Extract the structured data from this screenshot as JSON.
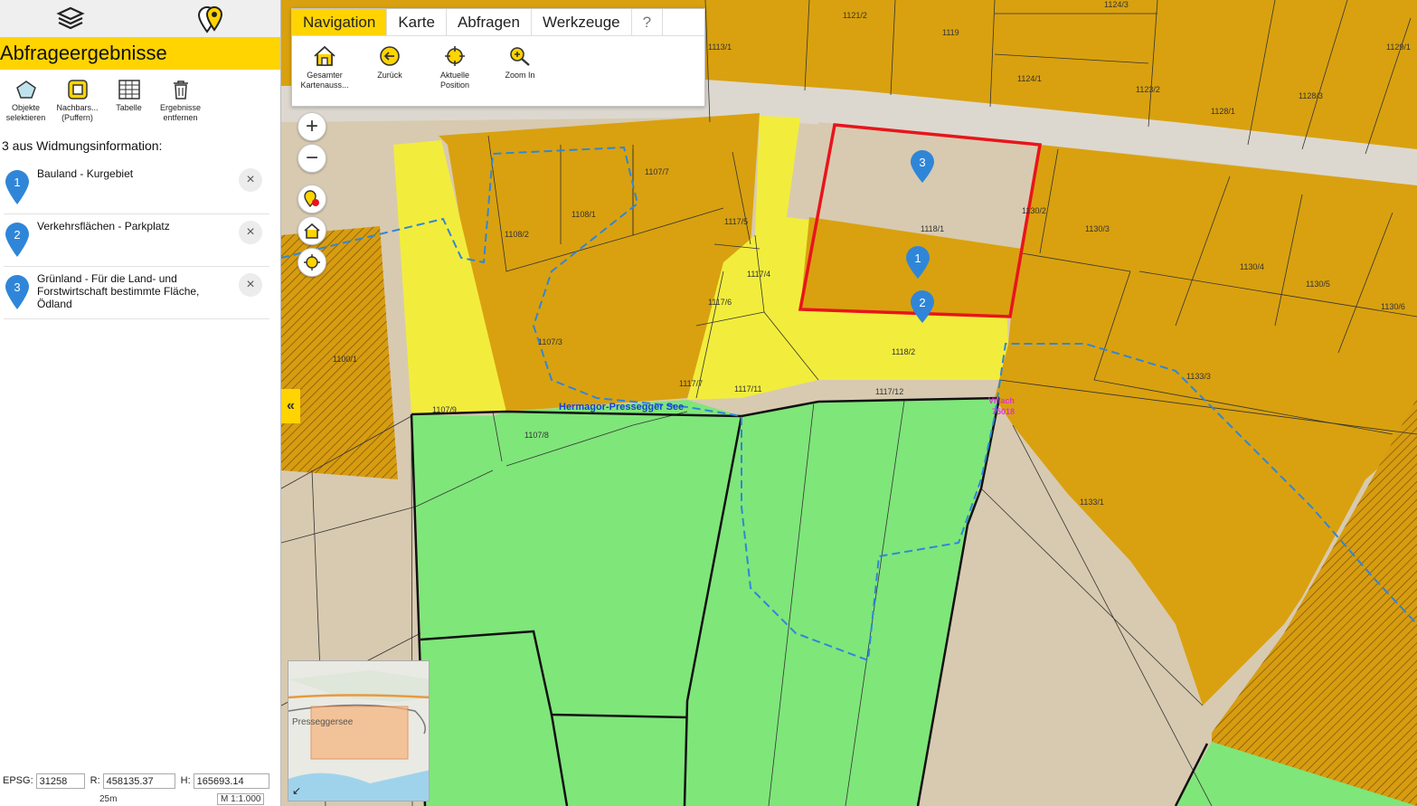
{
  "panel": {
    "title": "Abfrageergebnisse",
    "tabs": [
      "layers-icon",
      "query-pins-icon"
    ],
    "tools": [
      {
        "label_1": "Objekte",
        "label_2": "selektieren",
        "icon": "pentagon-select-icon"
      },
      {
        "label_1": "Nachbars...",
        "label_2": "(Puffern)",
        "icon": "buffer-icon"
      },
      {
        "label_1": "Tabelle",
        "label_2": "",
        "icon": "table-icon"
      },
      {
        "label_1": "Ergebnisse",
        "label_2": "entfernen",
        "icon": "trash-icon"
      }
    ],
    "result_heading": "3 aus Widmungsinformation:",
    "results": [
      {
        "num": "1",
        "text": "Bauland - Kurgebiet"
      },
      {
        "num": "2",
        "text": "Verkehrsflächen - Parkplatz"
      },
      {
        "num": "3",
        "text": "Grünland - Für die Land- und Forstwirtschaft bestimmte Fläche, Ödland"
      }
    ],
    "close_glyph": "×",
    "collapse_glyph": "«"
  },
  "status": {
    "epsg_label": "EPSG:",
    "epsg_value": "31258",
    "r_label": "R:",
    "r_value": "458135.37",
    "h_label": "H:",
    "h_value": "165693.14",
    "scale_bar": "25m",
    "scale_value": "M 1:1.000"
  },
  "menu": {
    "tabs": [
      "Navigation",
      "Karte",
      "Abfragen",
      "Werkzeuge",
      "?"
    ],
    "active_tab": "Navigation",
    "items": [
      {
        "label_1": "Gesamter",
        "label_2": "Kartenauss...",
        "icon": "home-icon"
      },
      {
        "label_1": "Zurück",
        "label_2": "",
        "icon": "back-arrow-icon"
      },
      {
        "label_1": "Aktuelle",
        "label_2": "Position",
        "icon": "crosshair-icon"
      },
      {
        "label_1": "Zoom In",
        "label_2": "",
        "icon": "zoom-in-icon"
      }
    ]
  },
  "map_controls": {
    "zoom_in": "+",
    "zoom_out": "−"
  },
  "map": {
    "parcels": [
      "1113/1",
      "1121/2",
      "1119",
      "1124/3",
      "1129/1",
      "1124/1",
      "1123/2",
      "1128/3",
      "1128/1",
      "1107/7",
      "1108/1",
      "1108/2",
      "1117/5",
      "1117/4",
      "1117/6",
      "1118/1",
      "1130/2",
      "1130/3",
      "1130/4",
      "1130/5",
      "1130/6",
      "1133/3",
      "1100/1",
      "1107/3",
      "1118/2",
      "1117/7",
      "1117/11",
      "1117/12",
      "1107/9",
      "1107/8",
      "1133/1"
    ],
    "place_label": "Hermagor-Pressegger See",
    "cad_label_1": "Villach",
    "cad_label_2": "75018",
    "markers": [
      "1",
      "2",
      "3"
    ],
    "overview_label": "Presseggersee",
    "colors": {
      "bauland": "#d9a10f",
      "verkehr": "#f2ed3c",
      "gruenland": "#7fe67a",
      "background": "#d8cab0",
      "selection": "#e8141c",
      "accent": "#ffd400",
      "marker": "#2f86d8"
    }
  }
}
